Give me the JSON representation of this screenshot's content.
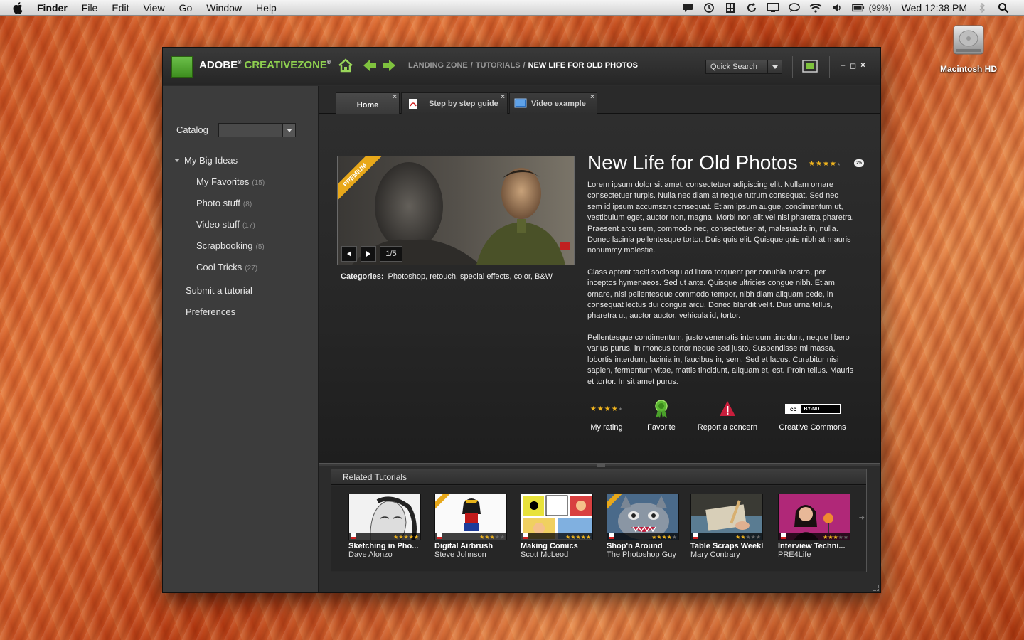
{
  "menubar": {
    "app": "Finder",
    "items": [
      "File",
      "Edit",
      "View",
      "Go",
      "Window",
      "Help"
    ],
    "battery": "(99%)",
    "clock": "Wed 12:38 PM"
  },
  "desktop": {
    "drive_label": "Macintosh HD"
  },
  "app": {
    "brand_adobe": "ADOBE",
    "brand_reg": "®",
    "brand_product": "CREATIVEZONE",
    "breadcrumb": [
      "LANDING ZONE",
      "TUTORIALS",
      "NEW LIFE FOR OLD PHOTOS"
    ],
    "breadcrumb_sep": "/",
    "quick_search": "Quick Search",
    "controls": [
      "–",
      "◻",
      "×"
    ]
  },
  "sidebar": {
    "catalog_label": "Catalog",
    "catalog_value": "",
    "root": "My Big Ideas",
    "items": [
      {
        "label": "My Favorites",
        "count": "(15)"
      },
      {
        "label": "Photo stuff",
        "count": "(8)"
      },
      {
        "label": "Video stuff",
        "count": "(17)"
      },
      {
        "label": "Scrapbooking",
        "count": "(5)"
      },
      {
        "label": "Cool Tricks",
        "count": "(27)"
      }
    ],
    "submit": "Submit a tutorial",
    "preferences": "Preferences"
  },
  "tabs": [
    {
      "label": "Home",
      "active": true
    },
    {
      "label": "Step by step guide",
      "active": false
    },
    {
      "label": "Video example",
      "active": false
    }
  ],
  "tutorial": {
    "title": "New Life for Old Photos",
    "rating_stars": 4,
    "review_count": "25",
    "premium_label": "PREMIUM",
    "slide_counter": "1/5",
    "categories_label": "Categories:",
    "categories": "Photoshop, retouch, special effects, color, B&W",
    "paragraphs": [
      "Lorem ipsum dolor sit amet, consectetuer adipiscing elit. Nullam ornare consectetuer turpis. Nulla nec diam at neque rutrum consequat. Sed nec sem id ipsum accumsan consequat. Etiam ipsum augue, condimentum ut, vestibulum eget, auctor non, magna. Morbi non elit vel nisl pharetra pharetra. Praesent arcu sem, commodo nec, consectetuer at, malesuada in, nulla. Donec lacinia pellentesque tortor. Duis quis elit. Quisque quis nibh at mauris nonummy molestie.",
      "Class aptent taciti sociosqu ad litora torquent per conubia nostra, per inceptos hymenaeos. Sed ut ante. Quisque ultricies congue nibh. Etiam ornare, nisi pellentesque commodo tempor, nibh diam aliquam pede, in consequat lectus dui congue arcu. Donec blandit velit. Duis urna tellus, pharetra ut, auctor auctor, vehicula id, tortor.",
      "Pellentesque condimentum, justo venenatis interdum tincidunt, neque libero varius purus, in rhoncus tortor neque sed justo. Suspendisse mi massa, lobortis interdum, lacinia in, faucibus in, sem. Sed et lacus. Curabitur nisi sapien, fermentum vitae, mattis tincidunt, aliquam et, est. Proin tellus. Mauris et tortor. In sit amet purus."
    ],
    "actions": {
      "my_rating": "My rating",
      "my_rating_stars": 4,
      "favorite": "Favorite",
      "report": "Report a concern",
      "cc": "Creative Commons",
      "cc_badge": "BY-ND"
    }
  },
  "related": {
    "heading": "Related Tutorials",
    "items": [
      {
        "title": "Sketching in Pho...",
        "author": "Dave Alonzo",
        "stars": 5,
        "premium": false,
        "author_link": true
      },
      {
        "title": "Digital Airbrush",
        "author": "Steve Johnson",
        "stars": 3,
        "premium": true,
        "author_link": true
      },
      {
        "title": "Making Comics",
        "author": "Scott McLeod",
        "stars": 5,
        "premium": false,
        "author_link": true
      },
      {
        "title": "Shop'n Around",
        "author": "The Photoshop Guy",
        "stars": 4,
        "premium": true,
        "author_link": true
      },
      {
        "title": "Table Scraps Weekly",
        "author": "Mary Contrary",
        "stars": 2,
        "premium": false,
        "author_link": true
      },
      {
        "title": "Interview Techni...",
        "author": "PRE4Life",
        "stars": 3,
        "premium": false,
        "author_link": false
      }
    ]
  },
  "colors": {
    "accent_green": "#8fd14f",
    "star_gold": "#f0b41e",
    "premium_orange": "#e8a81a"
  }
}
